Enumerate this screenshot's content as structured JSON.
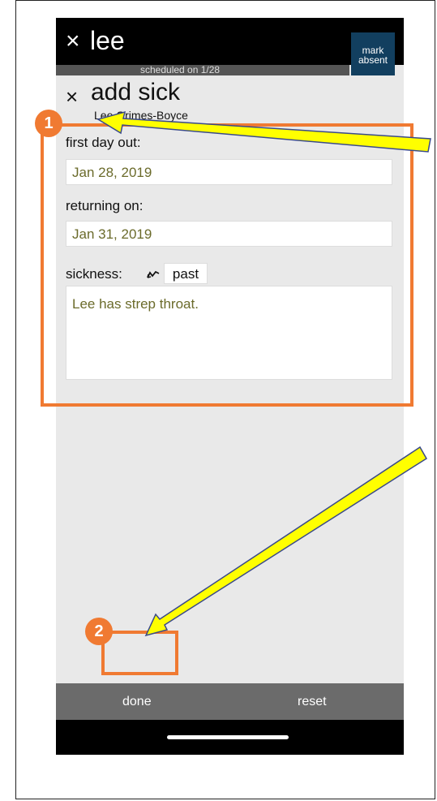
{
  "header": {
    "close_glyph": "×",
    "name": "lee",
    "scheduled": "scheduled on 1/28",
    "mark_absent_line1": "mark",
    "mark_absent_line2": "absent"
  },
  "sheet": {
    "close_glyph": "×",
    "title": "add sick",
    "person": "Lee Grimes-Boyce",
    "first_day_label": "first day out:",
    "first_day_value": "Jan 28, 2019",
    "returning_label": "returning on:",
    "returning_value": "Jan 31, 2019",
    "sickness_label": "sickness:",
    "past_button": "past",
    "notes": "Lee has strep throat."
  },
  "footer": {
    "done_label": "done",
    "reset_label": "reset"
  },
  "callouts": {
    "badge_1": "1",
    "badge_2": "2"
  },
  "colors": {
    "accent": "#f07a32",
    "arrow_fill": "#ffff00",
    "mark_absent_bg": "#123f5f",
    "field_text": "#6b6b2b"
  }
}
